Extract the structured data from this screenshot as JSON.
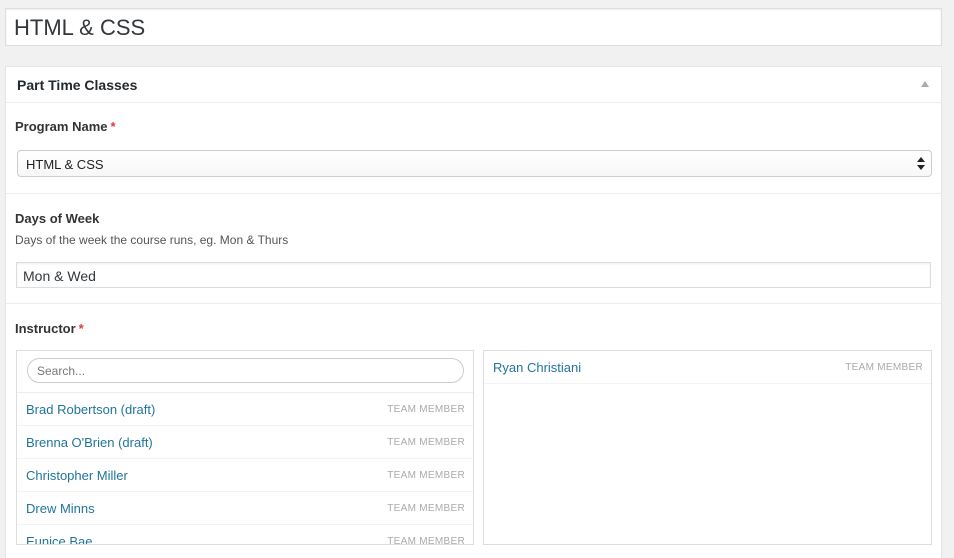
{
  "title": {
    "value": "HTML & CSS"
  },
  "metabox": {
    "title": "Part Time Classes",
    "program_name": {
      "label": "Program Name",
      "required_mark": "*",
      "selected": "HTML & CSS"
    },
    "days_of_week": {
      "label": "Days of Week",
      "description": "Days of the week the course runs, eg. Mon & Thurs",
      "value": "Mon & Wed"
    },
    "instructor": {
      "label": "Instructor",
      "required_mark": "*",
      "search_placeholder": "Search...",
      "choices": [
        {
          "name": "Brad Robertson (draft)",
          "type": "TEAM MEMBER"
        },
        {
          "name": "Brenna O'Brien (draft)",
          "type": "TEAM MEMBER"
        },
        {
          "name": "Christopher Miller",
          "type": "TEAM MEMBER"
        },
        {
          "name": "Drew Minns",
          "type": "TEAM MEMBER"
        },
        {
          "name": "Eunice Bae",
          "type": "TEAM MEMBER"
        }
      ],
      "selected": [
        {
          "name": "Ryan Christiani",
          "type": "TEAM MEMBER"
        }
      ]
    }
  }
}
